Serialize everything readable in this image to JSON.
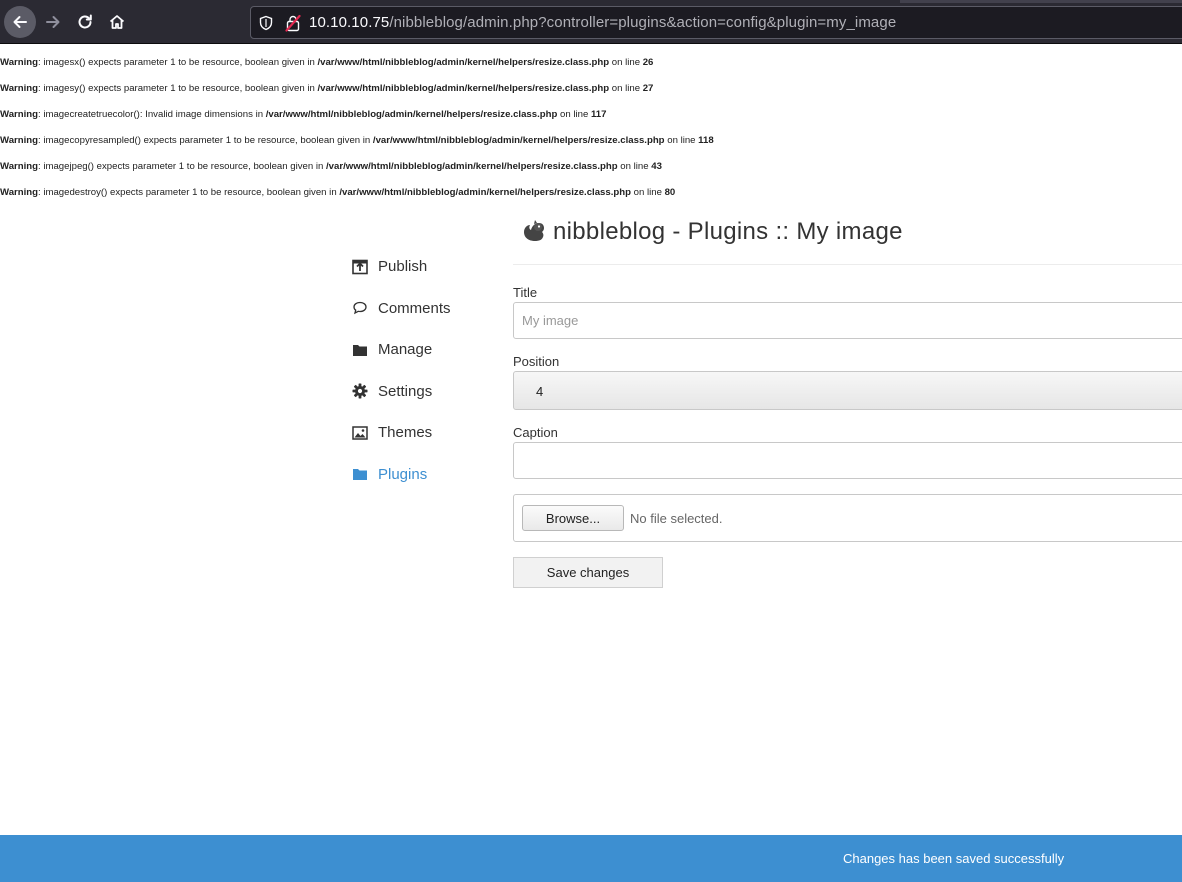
{
  "browser": {
    "url_host": "10.10.10.75",
    "url_path": "/nibbleblog/admin.php?controller=plugins&action=config&plugin=my_image"
  },
  "warnings": [
    {
      "label": "Warning",
      "message": ": imagesx() expects parameter 1 to be resource, boolean given in ",
      "file": "/var/www/html/nibbleblog/admin/kernel/helpers/resize.class.php",
      "online": " on line ",
      "line": "26"
    },
    {
      "label": "Warning",
      "message": ": imagesy() expects parameter 1 to be resource, boolean given in ",
      "file": "/var/www/html/nibbleblog/admin/kernel/helpers/resize.class.php",
      "online": " on line ",
      "line": "27"
    },
    {
      "label": "Warning",
      "message": ": imagecreatetruecolor(): Invalid image dimensions in ",
      "file": "/var/www/html/nibbleblog/admin/kernel/helpers/resize.class.php",
      "online": " on line ",
      "line": "117"
    },
    {
      "label": "Warning",
      "message": ": imagecopyresampled() expects parameter 1 to be resource, boolean given in ",
      "file": "/var/www/html/nibbleblog/admin/kernel/helpers/resize.class.php",
      "online": " on line ",
      "line": "118"
    },
    {
      "label": "Warning",
      "message": ": imagejpeg() expects parameter 1 to be resource, boolean given in ",
      "file": "/var/www/html/nibbleblog/admin/kernel/helpers/resize.class.php",
      "online": " on line ",
      "line": "43"
    },
    {
      "label": "Warning",
      "message": ": imagedestroy() expects parameter 1 to be resource, boolean given in ",
      "file": "/var/www/html/nibbleblog/admin/kernel/helpers/resize.class.php",
      "online": " on line ",
      "line": "80"
    }
  ],
  "sidebar": {
    "items": [
      {
        "label": "Publish",
        "icon": "publish-icon"
      },
      {
        "label": "Comments",
        "icon": "comment-icon"
      },
      {
        "label": "Manage",
        "icon": "folder-icon"
      },
      {
        "label": "Settings",
        "icon": "gear-icon"
      },
      {
        "label": "Themes",
        "icon": "image-icon"
      },
      {
        "label": "Plugins",
        "icon": "folder-open-icon",
        "active": true
      }
    ],
    "active_color": "#3d8fd1"
  },
  "main": {
    "title": "nibbleblog - Plugins :: My image",
    "title_label": "Title",
    "title_placeholder": "My image",
    "position_label": "Position",
    "position_value": "4",
    "caption_label": "Caption",
    "caption_value": "",
    "browse_label": "Browse...",
    "file_status": "No file selected.",
    "save_label": "Save changes"
  },
  "notification": {
    "text": "Changes has been saved successfully",
    "color": "#3d8fd1"
  }
}
